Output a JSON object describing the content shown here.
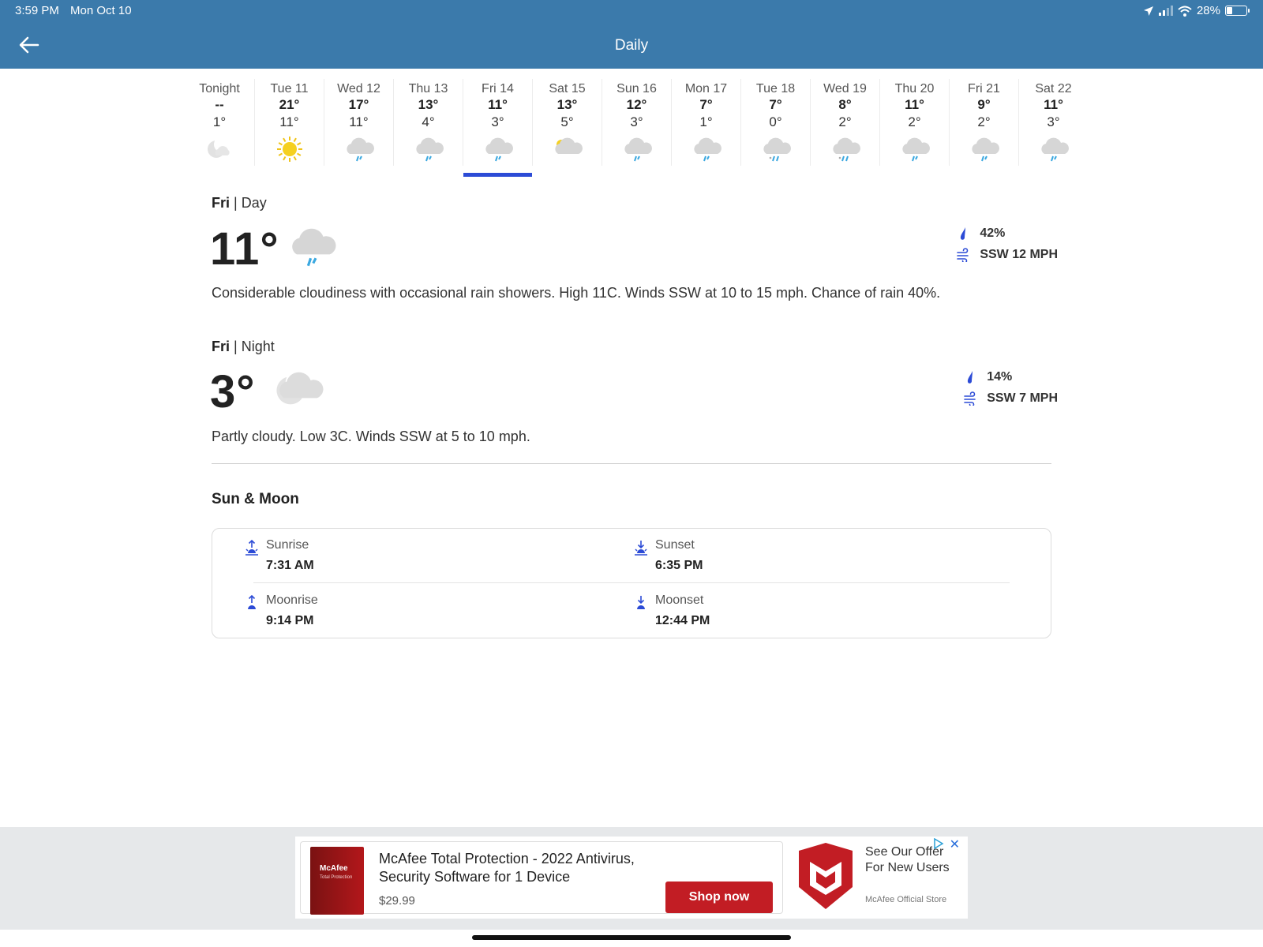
{
  "status_bar": {
    "time": "3:59 PM",
    "date": "Mon Oct 10",
    "battery": "28%",
    "battery_level": 0.28
  },
  "header": {
    "title": "Daily",
    "back_icon": "arrow-left-icon"
  },
  "days": [
    {
      "name": "Tonight",
      "hi": "--",
      "lo": "1°",
      "icon": "moon-icon"
    },
    {
      "name": "Tue 11",
      "hi": "21°",
      "lo": "11°",
      "icon": "sun-icon"
    },
    {
      "name": "Wed 12",
      "hi": "17°",
      "lo": "11°",
      "icon": "rain-cloud-icon"
    },
    {
      "name": "Thu 13",
      "hi": "13°",
      "lo": "4°",
      "icon": "rain-cloud-icon"
    },
    {
      "name": "Fri 14",
      "hi": "11°",
      "lo": "3°",
      "icon": "rain-cloud-icon",
      "selected": true
    },
    {
      "name": "Sat 15",
      "hi": "13°",
      "lo": "5°",
      "icon": "partly-sunny-icon"
    },
    {
      "name": "Sun 16",
      "hi": "12°",
      "lo": "3°",
      "icon": "rain-cloud-icon"
    },
    {
      "name": "Mon 17",
      "hi": "7°",
      "lo": "1°",
      "icon": "rain-cloud-icon"
    },
    {
      "name": "Tue 18",
      "hi": "7°",
      "lo": "0°",
      "icon": "rain-snow-cloud-icon"
    },
    {
      "name": "Wed 19",
      "hi": "8°",
      "lo": "2°",
      "icon": "rain-snow-cloud-icon"
    },
    {
      "name": "Thu 20",
      "hi": "11°",
      "lo": "2°",
      "icon": "rain-cloud-icon"
    },
    {
      "name": "Fri 21",
      "hi": "9°",
      "lo": "2°",
      "icon": "rain-cloud-icon"
    },
    {
      "name": "Sat 22",
      "hi": "11°",
      "lo": "3°",
      "icon": "rain-cloud-icon"
    }
  ],
  "day_detail": {
    "day": "Fri",
    "period": "| Day",
    "temp": "11°",
    "icon": "rain-cloud-icon",
    "precip": "42%",
    "wind": "SSW 12 MPH",
    "description": "Considerable cloudiness with occasional rain showers. High 11C. Winds SSW at 10 to 15 mph. Chance of rain 40%."
  },
  "night_detail": {
    "day": "Fri",
    "period": "| Night",
    "temp": "3°",
    "icon": "partly-cloudy-night-icon",
    "precip": "14%",
    "wind": "SSW 7 MPH",
    "description": "Partly cloudy. Low 3C. Winds SSW at 5 to 10 mph."
  },
  "sun_moon": {
    "title": "Sun & Moon",
    "sunrise_label": "Sunrise",
    "sunrise": "7:31 AM",
    "sunset_label": "Sunset",
    "sunset": "6:35 PM",
    "moonrise_label": "Moonrise",
    "moonrise": "9:14 PM",
    "moonset_label": "Moonset",
    "moonset": "12:44 PM"
  },
  "ad": {
    "title": "McAfee Total Protection - 2022 Antivirus, Security Software for 1 Device",
    "price": "$29.99",
    "button": "Shop now",
    "offer": "See Our Offer For New Users",
    "store": "McAfee Official Store",
    "product_brand": "McAfee",
    "product_name": "Total Protection",
    "brand_color": "#c21d24"
  },
  "colors": {
    "header": "#3b7aab",
    "selected_underline": "#2c4bd6",
    "icon_blue": "#2c4bd6"
  }
}
